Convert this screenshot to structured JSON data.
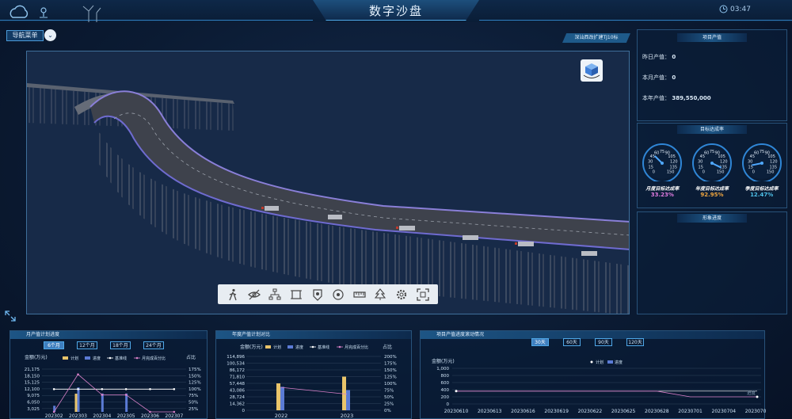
{
  "header": {
    "title": "数字沙盘",
    "time": "03:47"
  },
  "nav": {
    "menu_label": "导航菜单",
    "chevron": "⌄"
  },
  "location_tag": "深汕西改扩建TJ10标",
  "toolbar_icons": [
    "walk-icon",
    "hide-icon",
    "structure-icon",
    "frame-icon",
    "marker-icon",
    "target-icon",
    "measure-icon",
    "tree-icon",
    "settings-icon",
    "fullscreen-icon"
  ],
  "project_output": {
    "title": "项目产值",
    "rows": [
      {
        "label": "昨日产值：",
        "value": "0"
      },
      {
        "label": "本月产值：",
        "value": "0"
      },
      {
        "label": "本年产值：",
        "value": "389,550,000"
      }
    ]
  },
  "targets": {
    "title": "目标达成率",
    "gauges": [
      {
        "label": "月度目标达成率",
        "value": "33.23%",
        "fraction": 0.3323,
        "color": "#e07be0"
      },
      {
        "label": "年度目标达成率",
        "value": "92.95%",
        "fraction": 0.9295,
        "color": "#f0a640"
      },
      {
        "label": "季度目标达成率",
        "value": "12.47%",
        "fraction": 0.1247,
        "color": "#4fc1e8"
      }
    ],
    "scale": [
      "15",
      "30",
      "45",
      "60",
      "75",
      "90",
      "105",
      "120",
      "135",
      "150",
      "0",
      "0"
    ]
  },
  "progress_title": "形象进度",
  "monthly": {
    "title": "月产值计划进度",
    "tabs": [
      "6个月",
      "12个月",
      "18个月",
      "24个月"
    ],
    "active_tab": 0,
    "y_title": "金额(万元)",
    "y2_title": "占比",
    "legend": [
      "计划",
      "进度",
      "基准线",
      "月完成百分比"
    ],
    "yticks": [
      "21,175",
      "18,150",
      "15,125",
      "12,100",
      "9,075",
      "6,050",
      "3,025"
    ],
    "y2ticks": [
      "175%",
      "150%",
      "125%",
      "100%",
      "75%",
      "50%",
      "25%"
    ]
  },
  "yearly": {
    "title": "年度产值计划对比",
    "y_title": "金额(万元)",
    "y2_title": "占比",
    "legend": [
      "计划",
      "进度",
      "基准线",
      "月完成百分比"
    ],
    "yticks": [
      "114,896",
      "100,534",
      "86,172",
      "71,810",
      "57,448",
      "43,086",
      "28,724",
      "14,362",
      "0"
    ],
    "y2ticks": [
      "200%",
      "175%",
      "150%",
      "125%",
      "100%",
      "75%",
      "50%",
      "25%",
      "0%"
    ]
  },
  "rolling": {
    "title": "项目产值进度滚动情况",
    "tabs": [
      "30天",
      "60天",
      "90天",
      "120天"
    ],
    "active_tab": 0,
    "y_title": "金额(万元)",
    "legend": [
      "计划",
      "进度"
    ],
    "yticks": [
      "1,000",
      "800",
      "600",
      "400",
      "200",
      "0"
    ],
    "corner_label": "进度"
  },
  "colors": {
    "plan": "#e9c46a",
    "progress": "#5b7bd5",
    "baseline": "#ffffff",
    "pct": "#d980c8"
  },
  "chart_data": [
    {
      "type": "bar",
      "title": "月产值计划进度",
      "categories": [
        "202302",
        "202303",
        "202304",
        "202305",
        "202306",
        "202307"
      ],
      "ylabel": "金额(万元)",
      "ylim": [
        0,
        21175
      ],
      "series": [
        {
          "name": "计划",
          "values": [
            0,
            9000,
            0,
            0,
            0,
            0
          ]
        },
        {
          "name": "进度",
          "values": [
            3025,
            12100,
            9075,
            9075,
            0,
            0
          ]
        },
        {
          "name": "基准线",
          "values": [
            100,
            100,
            100,
            100,
            100,
            100
          ]
        },
        {
          "name": "月完成百分比",
          "values": [
            0,
            165,
            75,
            75,
            0,
            0
          ]
        }
      ]
    },
    {
      "type": "bar",
      "title": "年度产值计划对比",
      "categories": [
        "2022",
        "2023"
      ],
      "ylabel": "金额(万元)",
      "ylim": [
        0,
        114896
      ],
      "series": [
        {
          "name": "计划",
          "values": [
            57448,
            71810
          ]
        },
        {
          "name": "进度",
          "values": [
            50000,
            43086
          ]
        },
        {
          "name": "月完成百分比",
          "values": [
            85,
            60
          ]
        }
      ]
    },
    {
      "type": "line",
      "title": "项目产值进度滚动情况",
      "categories": [
        "20230610",
        "20230613",
        "20230616",
        "20230619",
        "20230622",
        "20230625",
        "20230628",
        "20230701",
        "20230704",
        "20230707"
      ],
      "ylabel": "金额(万元)",
      "ylim": [
        0,
        1000
      ],
      "series": [
        {
          "name": "计划",
          "values": [
            360,
            360,
            360,
            360,
            360,
            360,
            360,
            360,
            360,
            360
          ]
        },
        {
          "name": "进度",
          "values": [
            360,
            360,
            360,
            360,
            360,
            360,
            360,
            200,
            200,
            200
          ]
        }
      ]
    }
  ]
}
